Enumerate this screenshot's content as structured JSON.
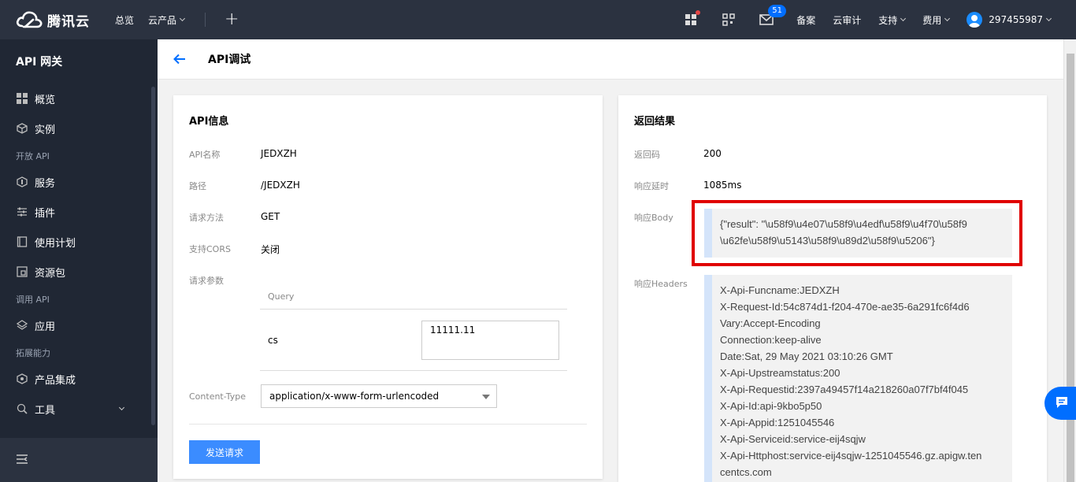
{
  "topbar": {
    "brand": "腾讯云",
    "nav": [
      "总览",
      "云产品"
    ],
    "plus": "+",
    "message_count": "51",
    "links": [
      "备案",
      "云审计",
      "支持",
      "费用"
    ],
    "account": "297455987"
  },
  "sidebar": {
    "title": "API 网关",
    "items": [
      {
        "label": "概览"
      },
      {
        "label": "实例"
      }
    ],
    "group1": "开放 API",
    "group1_items": [
      {
        "label": "服务"
      },
      {
        "label": "插件"
      },
      {
        "label": "使用计划"
      },
      {
        "label": "资源包"
      }
    ],
    "group2": "调用 API",
    "group2_items": [
      {
        "label": "应用"
      }
    ],
    "group3": "拓展能力",
    "group3_items": [
      {
        "label": "产品集成"
      },
      {
        "label": "工具"
      }
    ]
  },
  "page": {
    "title": "API调试"
  },
  "api_info": {
    "title": "API信息",
    "name_label": "API名称",
    "name": "JEDXZH",
    "path_label": "路径",
    "path": "/JEDXZH",
    "method_label": "请求方法",
    "method": "GET",
    "cors_label": "支持CORS",
    "cors": "关闭",
    "params_label": "请求参数",
    "query_header": "Query",
    "param_key": "cs",
    "param_value": "11111.11",
    "content_type_label": "Content-Type",
    "content_type": "application/x-www-form-urlencoded",
    "send_label": "发送请求"
  },
  "result": {
    "title": "返回结果",
    "code_label": "返回码",
    "code": "200",
    "latency_label": "响应延时",
    "latency": "1085ms",
    "body_label": "响应Body",
    "body_line1": "{\"result\": \"\\u58f9\\u4e07\\u58f9\\u4edf\\u58f9\\u4f70\\u58f9",
    "body_line2": "\\u62fe\\u58f9\\u5143\\u58f9\\u89d2\\u58f9\\u5206\"}",
    "headers_label": "响应Headers",
    "headers": [
      "X-Api-Funcname:JEDXZH",
      "X-Request-Id:54c874d1-f204-470e-ae35-6a291fc6f4d6",
      "Vary:Accept-Encoding",
      "Connection:keep-alive",
      "Date:Sat, 29 May 2021 03:10:26 GMT",
      "X-Api-Upstreamstatus:200",
      "X-Api-Requestid:2397a49457f14a218260a07f7bf4f045",
      "X-Api-Id:api-9kbo5p50",
      "X-Api-Appid:1251045546",
      "X-Api-Serviceid:service-eij4sqjw",
      "X-Api-Httphost:service-eij4sqjw-1251045546.gz.apigw.ten",
      "centcs.com"
    ]
  },
  "colors": {
    "topbar": "#2b3240",
    "sidebar": "#202734",
    "accent": "#006eff",
    "button": "#3b8cff",
    "highlight": "#e00000"
  }
}
